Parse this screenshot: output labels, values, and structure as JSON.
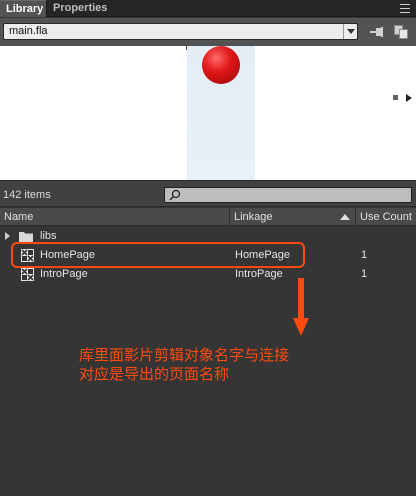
{
  "tabs": [
    {
      "label": "Library",
      "active": true
    },
    {
      "label": "Properties",
      "active": false
    }
  ],
  "document_selector": {
    "value": "main.fla"
  },
  "status": {
    "item_count": "142 items"
  },
  "search": {
    "placeholder": ""
  },
  "columns": {
    "name": "Name",
    "linkage": "Linkage",
    "use_count": "Use Count"
  },
  "items": [
    {
      "type": "folder",
      "name": "libs",
      "linkage": "",
      "use_count": ""
    },
    {
      "type": "movieclip",
      "name": "HomePage",
      "linkage": "HomePage",
      "use_count": "1"
    },
    {
      "type": "movieclip",
      "name": "IntroPage",
      "linkage": "IntroPage",
      "use_count": "1"
    }
  ],
  "annotation": {
    "text": "库里面影片剪辑对象名字与连接\n对应是导出的页面名称",
    "color": "#ff4a10"
  },
  "colors": {
    "panel_bg": "#353535",
    "tab_active": "#535353",
    "preview_ball": "#e01818"
  },
  "icons": {
    "panel_menu": "panel-menu-icon",
    "pin": "pin-icon",
    "new_library": "new-library-icon",
    "search": "search-icon",
    "folder": "folder-icon",
    "movieclip": "movieclip-icon"
  }
}
